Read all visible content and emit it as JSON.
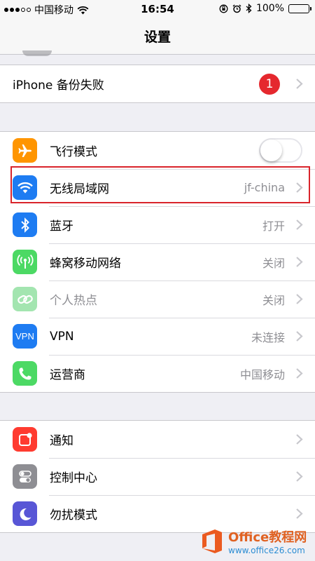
{
  "status_bar": {
    "carrier": "中国移动",
    "time": "16:54",
    "battery": "100%"
  },
  "nav": {
    "title": "设置"
  },
  "backup": {
    "label": "iPhone 备份失败",
    "badge": "1"
  },
  "connectivity": {
    "airplane": {
      "label": "飞行模式",
      "toggle_on": false
    },
    "wifi": {
      "label": "无线局域网",
      "value": "jf-china"
    },
    "bluetooth": {
      "label": "蓝牙",
      "value": "打开"
    },
    "cellular": {
      "label": "蜂窝移动网络",
      "value": "关闭"
    },
    "hotspot": {
      "label": "个人热点",
      "value": "关闭"
    },
    "vpn": {
      "label": "VPN",
      "value": "未连接",
      "icon_text": "VPN"
    },
    "carrier": {
      "label": "运营商",
      "value": "中国移动"
    }
  },
  "system": {
    "notifications": {
      "label": "通知"
    },
    "control_center": {
      "label": "控制中心"
    },
    "dnd": {
      "label": "勿扰模式"
    }
  },
  "colors": {
    "airplane": "#ff9500",
    "wifi": "#1e7cf2",
    "bluetooth": "#1e7cf2",
    "cellular": "#4cd964",
    "hotspot": "#a3e5b0",
    "vpn": "#1e7cf2",
    "carrier": "#4cd964",
    "notifications": "#ff3b30",
    "control_center": "#8e8e93",
    "dnd": "#5856d6",
    "highlight": "#d9242b"
  },
  "watermark": {
    "title": "Office教程网",
    "url": "www.office26.com"
  }
}
